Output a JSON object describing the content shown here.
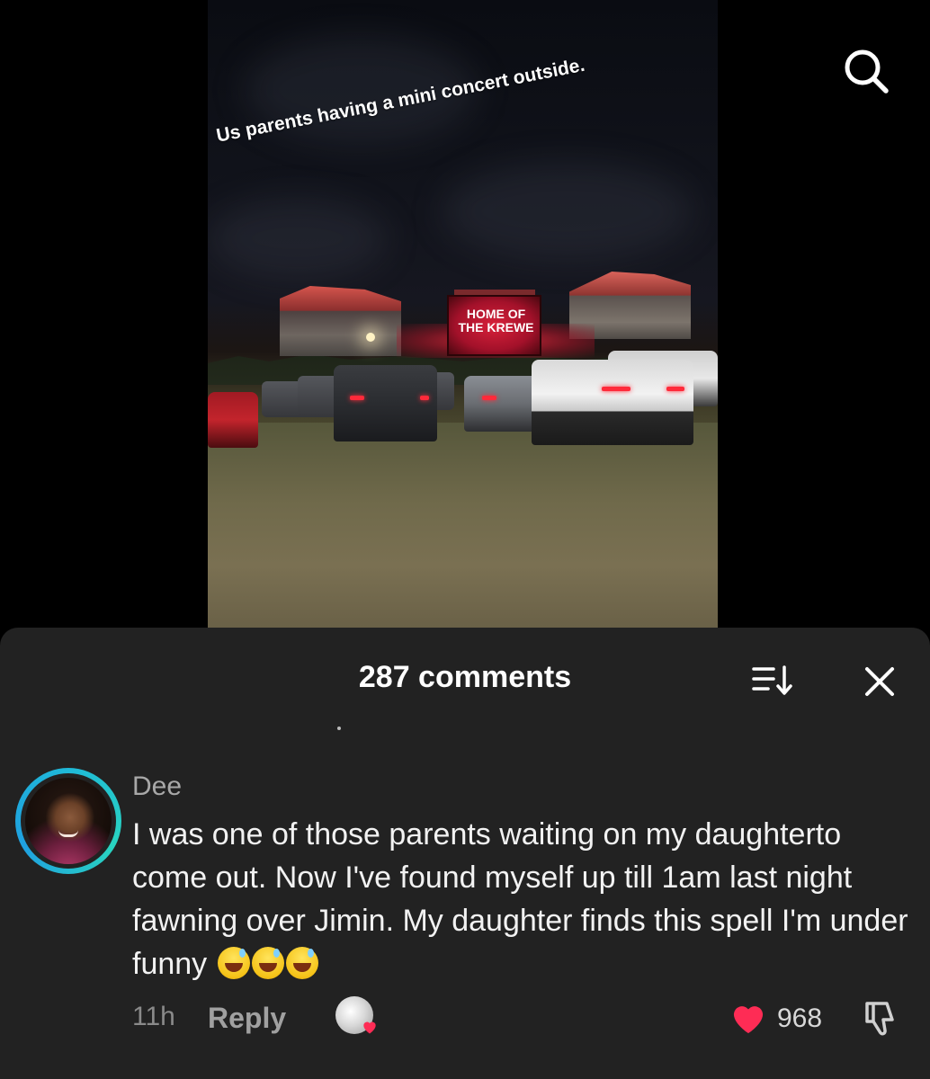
{
  "video": {
    "caption": "Us parents having a mini concert outside.",
    "scoreboard_line1": "HOME OF",
    "scoreboard_line2": "THE KREWE"
  },
  "sheet": {
    "title": "287 comments"
  },
  "comment": {
    "author": "Dee",
    "text": "I was one of those parents waiting on my daughterto come out. Now I've found myself up till 1am last night fawning over Jimin. My daughter finds this spell I'm under funny",
    "emoji_count": 3,
    "time": "11h",
    "reply_label": "Reply",
    "like_count": "968"
  },
  "icons": {
    "search": "search-icon",
    "sort": "sort-icon",
    "close": "close-icon",
    "like": "heart-icon",
    "dislike": "dislike-icon",
    "emoji": "sweat-smile-emoji"
  },
  "colors": {
    "sheet_bg": "#222222",
    "heart": "#fe2c55",
    "avatar_ring": "#1fb9d8"
  }
}
